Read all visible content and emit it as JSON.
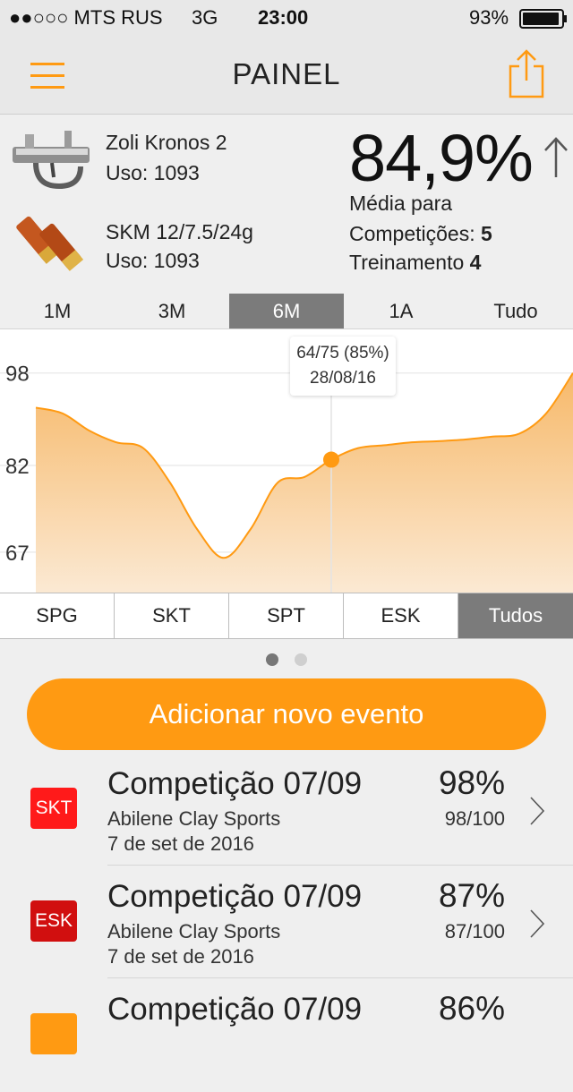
{
  "status_bar": {
    "carrier": "●●○○○ MTS RUS",
    "network": "3G",
    "time": "23:00",
    "battery": "93%"
  },
  "header": {
    "title": "PAINEL",
    "menu_icon": "hamburger-icon",
    "share_icon": "share-icon",
    "accent": "#ff9a12"
  },
  "equipment": {
    "gun_name": "Zoli Kronos 2",
    "gun_usage": "Uso: 1093",
    "ammo_name": "SKM 12/7.5/24g",
    "ammo_usage": "Uso: 1093"
  },
  "summary": {
    "average": "84,9%",
    "trend_icon": "arrow-up-icon",
    "average_label": "Média para",
    "competitions_label": "Competições:",
    "competitions_count": "5",
    "training_label": "Treinamento",
    "training_count": "4"
  },
  "periods": [
    "1M",
    "3M",
    "6M",
    "1A",
    "Tudo"
  ],
  "active_period": "6M",
  "tooltip": {
    "score": "64/75 (85%)",
    "date": "28/08/16"
  },
  "chart_data": {
    "type": "area",
    "y_ticks": [
      "98",
      "82",
      "67"
    ],
    "ylim": [
      60,
      104
    ],
    "x": [
      0,
      0.05,
      0.1,
      0.15,
      0.2,
      0.25,
      0.3,
      0.35,
      0.4,
      0.45,
      0.5,
      0.55,
      0.6,
      0.65,
      0.7,
      0.75,
      0.8,
      0.85,
      0.9,
      0.95,
      1.0
    ],
    "values": [
      92,
      91,
      88,
      86,
      85,
      79,
      71,
      66,
      71,
      79,
      80,
      83,
      85,
      85.5,
      86,
      86.2,
      86.5,
      87,
      87.5,
      91,
      98
    ],
    "highlight_index": 11,
    "fill_top": "#f7b96a",
    "fill_bottom": "#fbe9d3",
    "line_color": "#ff9a12"
  },
  "disciplines": [
    "SPG",
    "SKT",
    "SPT",
    "ESK",
    "Tudos"
  ],
  "active_discipline": "Tudos",
  "add_button": "Adicionar novo evento",
  "events": [
    {
      "badge": "SKT",
      "badge_color": "#ff1a1a",
      "title": "Competição 07/09",
      "place": "Abilene Clay Sports",
      "date": "7 de set de 2016",
      "pct": "98%",
      "score": "98/100"
    },
    {
      "badge": "ESK",
      "badge_color": "#d10f0f",
      "title": "Competição 07/09",
      "place": "Abilene Clay Sports",
      "date": "7 de set de 2016",
      "pct": "87%",
      "score": "87/100"
    },
    {
      "badge": "",
      "badge_color": "#ff9a12",
      "title": "Competição 07/09",
      "place": "",
      "date": "",
      "pct": "86%",
      "score": ""
    }
  ]
}
